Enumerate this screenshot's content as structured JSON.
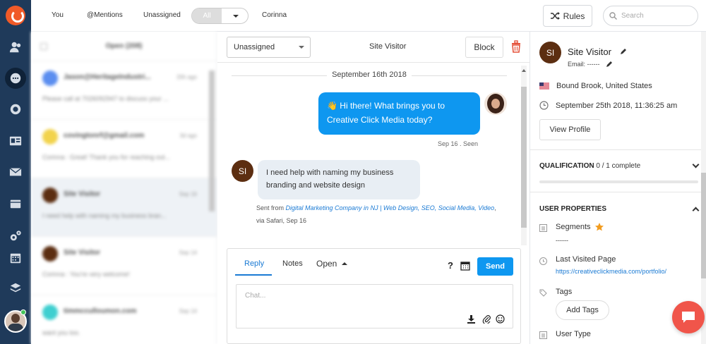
{
  "topbar": {
    "tabs": [
      "You",
      "@Mentions",
      "Unassigned"
    ],
    "segment_all": "All",
    "agent": "Corinna",
    "rules_label": "Rules",
    "search_placeholder": "Search"
  },
  "conversations": {
    "header": "Open (208)",
    "items": [
      {
        "name": "Jason@HeritageIndustri...",
        "time": "20h ago",
        "preview": "Please call at 7026092947 to discuss your ...",
        "avatar_color": "#5b8ef0",
        "selected": false
      },
      {
        "name": "covingtonrf@gmail.com",
        "time": "3d ago",
        "preview": "Corinna : Great! Thank you for reaching out...",
        "avatar_color": "#f2d34c",
        "selected": false
      },
      {
        "name": "Site Visitor",
        "time": "Sep 16",
        "preview": "I need help with naming my business bran...",
        "avatar_color": "#5c2e11",
        "selected": true
      },
      {
        "name": "Site Visitor",
        "time": "Sep 14",
        "preview": "Corinna : You're very welcome!",
        "avatar_color": "#5c2e11",
        "selected": false
      },
      {
        "name": "timmcculloumon.com",
        "time": "Sep 14",
        "preview": "want you too.",
        "avatar_color": "#3ecfd0",
        "selected": false
      }
    ]
  },
  "chat": {
    "assign_value": "Unassigned",
    "title": "Site Visitor",
    "block_label": "Block",
    "date_divider": "September 16th 2018",
    "agent_message_lines": [
      "👋 Hi there! What brings you to",
      "Creative Click Media today?"
    ],
    "seen": "Sep 16 . Seen",
    "visitor_initials": "SI",
    "visitor_message_lines": [
      "I need help with naming my business",
      "branding and website design"
    ],
    "sent_from_prefix": "Sent from ",
    "sent_from_link": "Digital Marketing Company in NJ | Web Design, SEO, Social Media, Video",
    "sent_from_suffix": ", via Safari, Sep 16",
    "reply_tabs": {
      "reply": "Reply",
      "notes": "Notes",
      "status": "Open"
    },
    "help": "?",
    "send_label": "Send",
    "input_placeholder": "Chat..."
  },
  "profile": {
    "initials": "SI",
    "name": "Site Visitor",
    "email_label": "Email: ------",
    "location": "Bound Brook, United States",
    "timestamp": "September 25th 2018, 11:36:25 am",
    "view_profile": "View Profile",
    "qualification_title": "QUALIFICATION",
    "qualification_progress": "0 / 1 complete",
    "user_properties_title": "USER PROPERTIES",
    "segments_label": "Segments",
    "segments_value": "------",
    "last_visited_label": "Last Visited Page",
    "last_visited_url": "https://creativeclickmedia.com/portfolio/",
    "tags_label": "Tags",
    "add_tags": "Add Tags",
    "user_type_label": "User Type"
  },
  "colors": {
    "nav": "#1f3a5a",
    "accent": "#0e97f0",
    "avatar": "#5c2e11",
    "fab": "#f0554a"
  }
}
